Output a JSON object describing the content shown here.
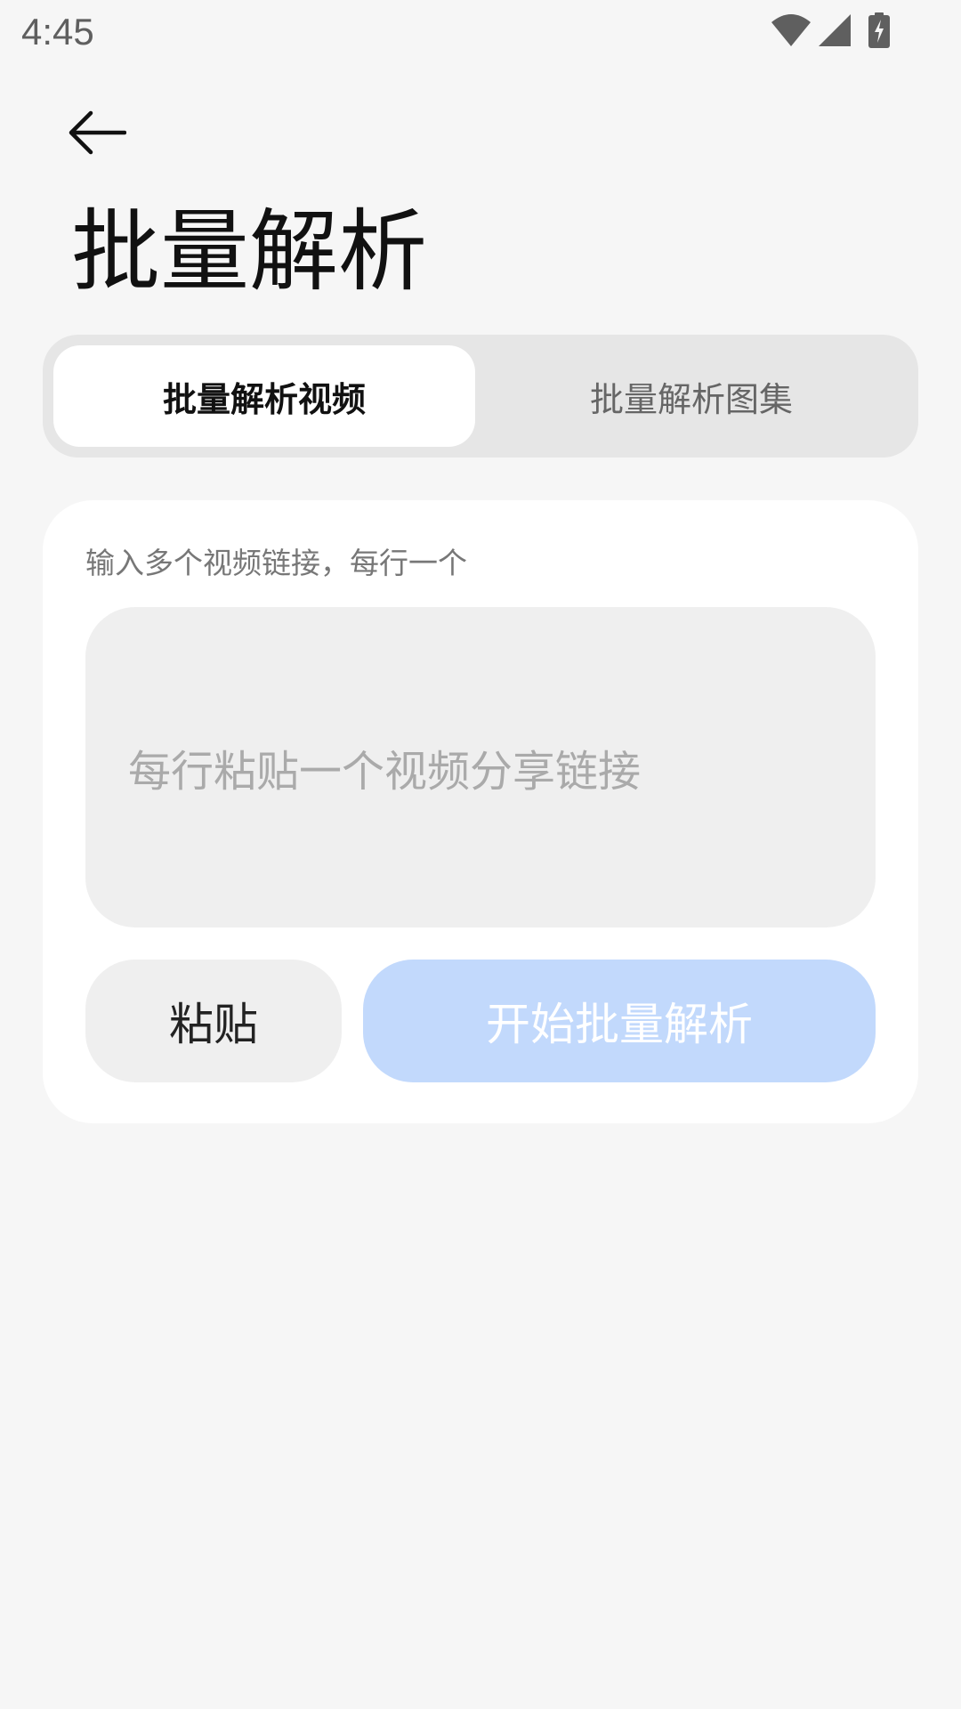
{
  "status_bar": {
    "time": "4:45",
    "icons": [
      "wifi-icon",
      "cellular-signal-icon",
      "battery-charging-icon"
    ]
  },
  "header": {
    "back_icon": "arrow-left-icon",
    "title": "批量解析"
  },
  "tabs": [
    {
      "label": "批量解析视频",
      "active": true
    },
    {
      "label": "批量解析图集",
      "active": false
    }
  ],
  "card": {
    "hint": "输入多个视频链接，每行一个",
    "textarea_placeholder": "每行粘贴一个视频分享链接",
    "paste_label": "粘贴",
    "start_label": "开始批量解析"
  },
  "colors": {
    "background": "#f6f6f6",
    "tab_track": "#e6e6e6",
    "card": "#ffffff",
    "input": "#efefef",
    "primary_disabled": "#c2d9fc"
  }
}
